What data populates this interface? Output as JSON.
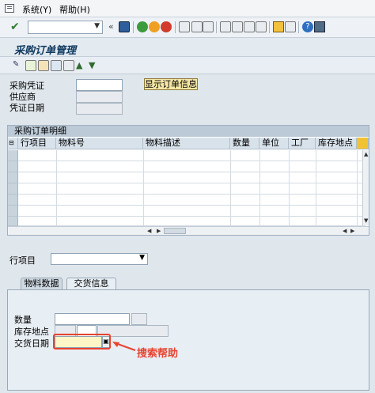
{
  "menubar": {
    "items": [
      "系统(Y)",
      "帮助(H)"
    ]
  },
  "toolbar": {
    "command_value": ""
  },
  "title": "采购订单管理",
  "header_fields": {
    "voucher_label": "采购凭证",
    "vendor_label": "供应商",
    "voucher_date_label": "凭证日期",
    "show_order_button": "显示订单信息"
  },
  "table": {
    "title": "采购订单明细",
    "columns": [
      "行项目",
      "物料号",
      "物料描述",
      "数量",
      "单位",
      "工厂",
      "库存地点"
    ]
  },
  "item_selector": {
    "label": "行项目",
    "value": ""
  },
  "tabs": [
    {
      "label": "物料数据",
      "active": false
    },
    {
      "label": "交货信息",
      "active": true
    }
  ],
  "delivery": {
    "quantity_label": "数量",
    "storage_label": "库存地点",
    "delivery_date_label": "交货日期"
  },
  "annotation": {
    "search_help_label": "搜索帮助",
    "color": "#e8422e"
  }
}
